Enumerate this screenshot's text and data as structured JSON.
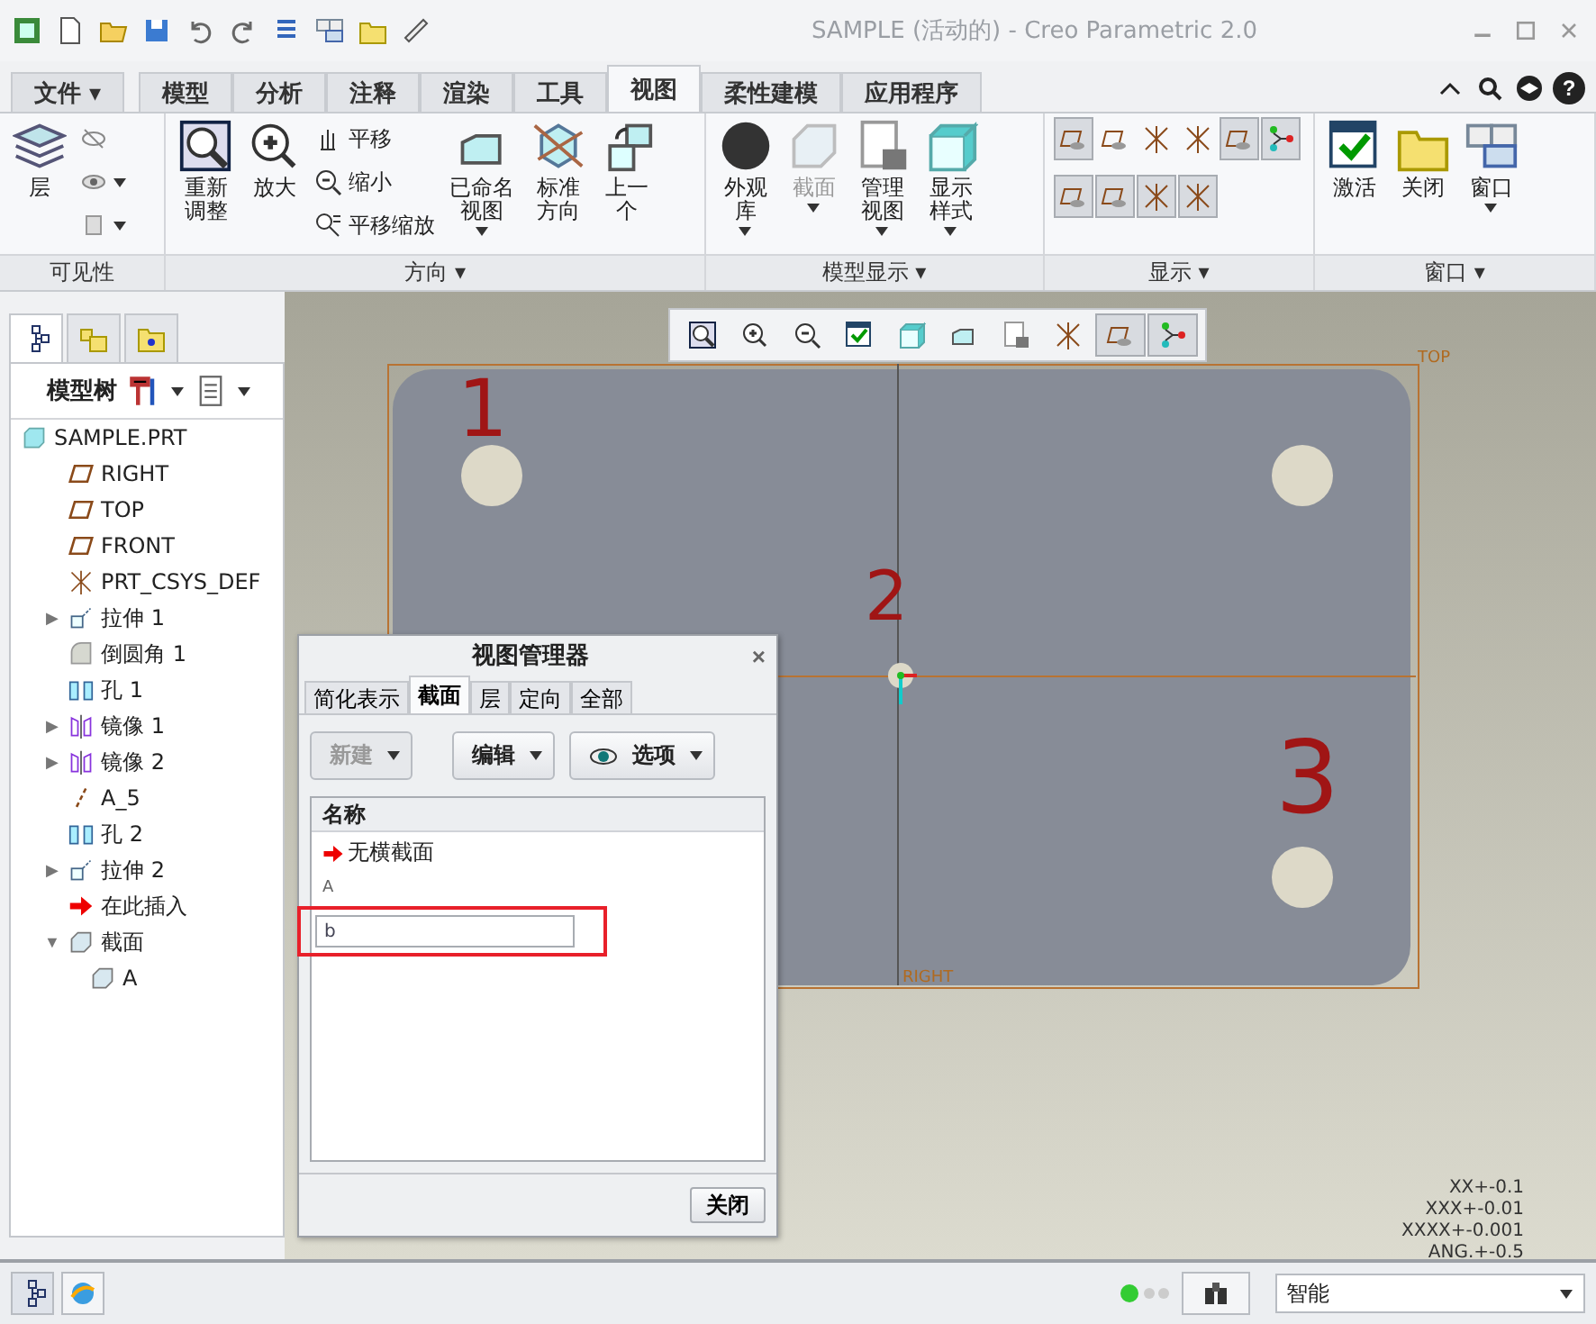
{
  "window": {
    "title": "SAMPLE (活动的) - Creo Parametric 2.0"
  },
  "ribbon_tabs": [
    {
      "label": "文件",
      "selected": false,
      "kind": "menu",
      "arrow": "▾"
    },
    {
      "label": "模型",
      "selected": false,
      "kind": "tab"
    },
    {
      "label": "分析",
      "selected": false,
      "kind": "tab"
    },
    {
      "label": "注释",
      "selected": false,
      "kind": "tab"
    },
    {
      "label": "渲染",
      "selected": false,
      "kind": "tab"
    },
    {
      "label": "工具",
      "selected": false,
      "kind": "tab"
    },
    {
      "label": "视图",
      "selected": true,
      "kind": "tab"
    },
    {
      "label": "柔性建模",
      "selected": false,
      "kind": "tab"
    },
    {
      "label": "应用程序",
      "selected": false,
      "kind": "tab"
    }
  ],
  "help_button": "?",
  "ribbon_groups": [
    {
      "label": "可见性",
      "items": [
        {
          "kind": "large",
          "label": "层"
        },
        {
          "kind": "stack",
          "entries": [
            {
              "dropdown": false
            },
            {
              "dropdown": true
            },
            {
              "dropdown": true
            }
          ]
        }
      ]
    },
    {
      "label": "方向",
      "arrow": "▾",
      "items": [
        {
          "kind": "large",
          "label": "重新调整"
        },
        {
          "kind": "large",
          "label": "放大"
        },
        {
          "kind": "stack",
          "entries": [
            {
              "label": "平移"
            },
            {
              "label": "缩小"
            },
            {
              "label": "平移缩放"
            }
          ]
        },
        {
          "kind": "large",
          "label": "已命名视图",
          "dropdown": true
        },
        {
          "kind": "large",
          "label": "标准方向"
        },
        {
          "kind": "large",
          "label": "上一个"
        }
      ]
    },
    {
      "label": "模型显示",
      "arrow": "▾",
      "items": [
        {
          "kind": "large",
          "label": "外观库",
          "dropdown": true
        },
        {
          "kind": "large",
          "label": "截面",
          "dropdown": true,
          "disabled": true
        },
        {
          "kind": "large",
          "label": "管理视图",
          "dropdown": true
        },
        {
          "kind": "large",
          "label": "显示样式",
          "dropdown": true
        }
      ]
    },
    {
      "label": "显示",
      "arrow": "▾",
      "items": [
        {
          "kind": "toggles",
          "rows": [
            [
              {
                "on": true
              },
              {
                "on": false
              },
              {
                "on": false
              },
              {
                "on": false
              },
              {
                "on": true
              },
              {
                "on": true
              }
            ],
            [
              {
                "on": true
              },
              {
                "on": true
              },
              {
                "on": true
              },
              {
                "on": true
              }
            ]
          ]
        }
      ]
    },
    {
      "label": "窗口",
      "arrow": "▾",
      "items": [
        {
          "kind": "large",
          "label": "激活"
        },
        {
          "kind": "large",
          "label": "关闭"
        },
        {
          "kind": "large",
          "label": "窗口",
          "dropdown": true
        }
      ]
    }
  ],
  "navigator": {
    "tabs": [
      {
        "selected": true
      },
      {
        "selected": false
      },
      {
        "selected": false
      }
    ],
    "title": "模型树",
    "tree": [
      {
        "label": "SAMPLE.PRT",
        "children": [
          {
            "label": "RIGHT"
          },
          {
            "label": "TOP"
          },
          {
            "label": "FRONT"
          },
          {
            "label": "PRT_CSYS_DEF"
          },
          {
            "label": "拉伸 1",
            "expander": "▶"
          },
          {
            "label": "倒圆角 1"
          },
          {
            "label": "孔 1"
          },
          {
            "label": "镜像 1",
            "expander": "▶"
          },
          {
            "label": "镜像 2",
            "expander": "▶"
          },
          {
            "label": "A_5"
          },
          {
            "label": "孔 2"
          },
          {
            "label": "拉伸 2",
            "expander": "▶"
          },
          {
            "label": "在此插入"
          },
          {
            "label": "截面",
            "expander": "▼",
            "children": [
              {
                "label": "A"
              }
            ]
          }
        ]
      }
    ]
  },
  "canvas": {
    "toolbar": [
      {
        "on": false
      },
      {
        "on": false
      },
      {
        "on": false
      },
      {
        "on": false
      },
      {
        "on": false
      },
      {
        "on": false
      },
      {
        "on": false
      },
      {
        "on": false
      },
      {
        "on": true
      },
      {
        "on": true
      }
    ],
    "labels": [
      "1",
      "2",
      "3"
    ],
    "plane_labels": [
      "TOP",
      "RIGHT"
    ],
    "tolerances": [
      "XX+-0.1",
      "XXX+-0.01",
      "XXXX+-0.001",
      "ANG.+-0.5"
    ]
  },
  "dialog": {
    "title": "视图管理器",
    "close": "×",
    "tabs": [
      {
        "label": "简化表示",
        "selected": false
      },
      {
        "label": "截面",
        "selected": true
      },
      {
        "label": "层",
        "selected": false
      },
      {
        "label": "定向",
        "selected": false
      },
      {
        "label": "全部",
        "selected": false
      }
    ],
    "buttons": [
      {
        "label": "新建",
        "disabled": true
      },
      {
        "label": "编辑",
        "disabled": false
      },
      {
        "label": "选项",
        "disabled": false
      }
    ],
    "column": "名称",
    "rows": [
      {
        "label": "无横截面",
        "active": true
      },
      {
        "label": "A",
        "active": false
      }
    ],
    "name_field": {
      "value": "b",
      "highlighted": true
    },
    "footer_button": "关闭"
  },
  "status_bar": {
    "filter": "智能"
  }
}
